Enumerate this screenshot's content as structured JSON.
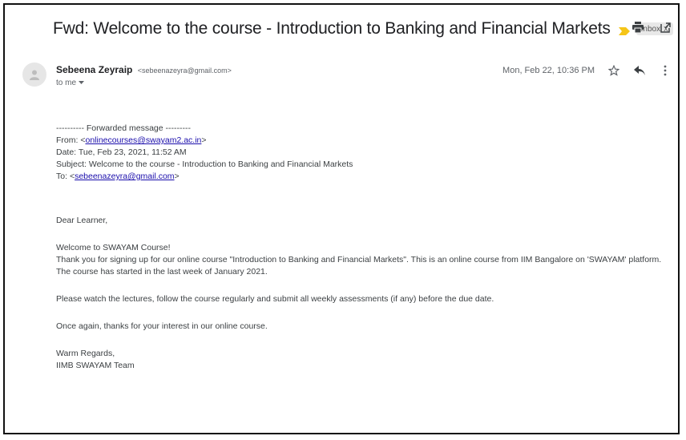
{
  "email": {
    "subject": "Fwd: Welcome to the course - Introduction to Banking and Financial Markets",
    "label": "Inbox",
    "label_close": "x",
    "sender_name": "Sebeena Zeyraip",
    "sender_email": "<sebeenazeyra@gmail.com>",
    "to_line": "to me",
    "date": "Mon, Feb 22, 10:36 PM",
    "forwarded": {
      "header": "---------- Forwarded message ---------",
      "from_label": "From: ",
      "from_link": "onlinecourses@swayam2.ac.in",
      "from_open": "<",
      "from_close": ">",
      "date": "Date: Tue, Feb 23, 2021, 11:52 AM",
      "subject": "Subject: Welcome to the course - Introduction to Banking and Financial Markets",
      "to_label": "To: ",
      "to_open": "<",
      "to_link": "sebeenazeyra@gmail.com",
      "to_close": ">"
    },
    "body": {
      "greeting": "Dear Learner,",
      "welcome": "Welcome to SWAYAM Course!",
      "para1": "Thank you for signing up for our online course \"Introduction to Banking and Financial Markets\". This is an online course from IIM Bangalore on 'SWAYAM' platform. The course has started in the last week of January 2021.",
      "para2": "Please watch the lectures, follow the course regularly and submit all weekly assessments (if any) before the due date.",
      "para3": "Once again, thanks for your interest in our online course.",
      "signoff": "Warm Regards,",
      "team": "IIMB SWAYAM Team"
    }
  },
  "icons": {
    "print": "print-icon",
    "open_new": "open-in-new-window-icon",
    "star": "star-icon",
    "reply": "reply-icon",
    "more": "more-vert-icon",
    "important": "important-marker-icon",
    "avatar": "person-icon",
    "dropdown": "chevron-down-icon"
  },
  "colors": {
    "link": "#1a0dab",
    "important_marker": "#f5c518",
    "text": "#3c4043"
  }
}
